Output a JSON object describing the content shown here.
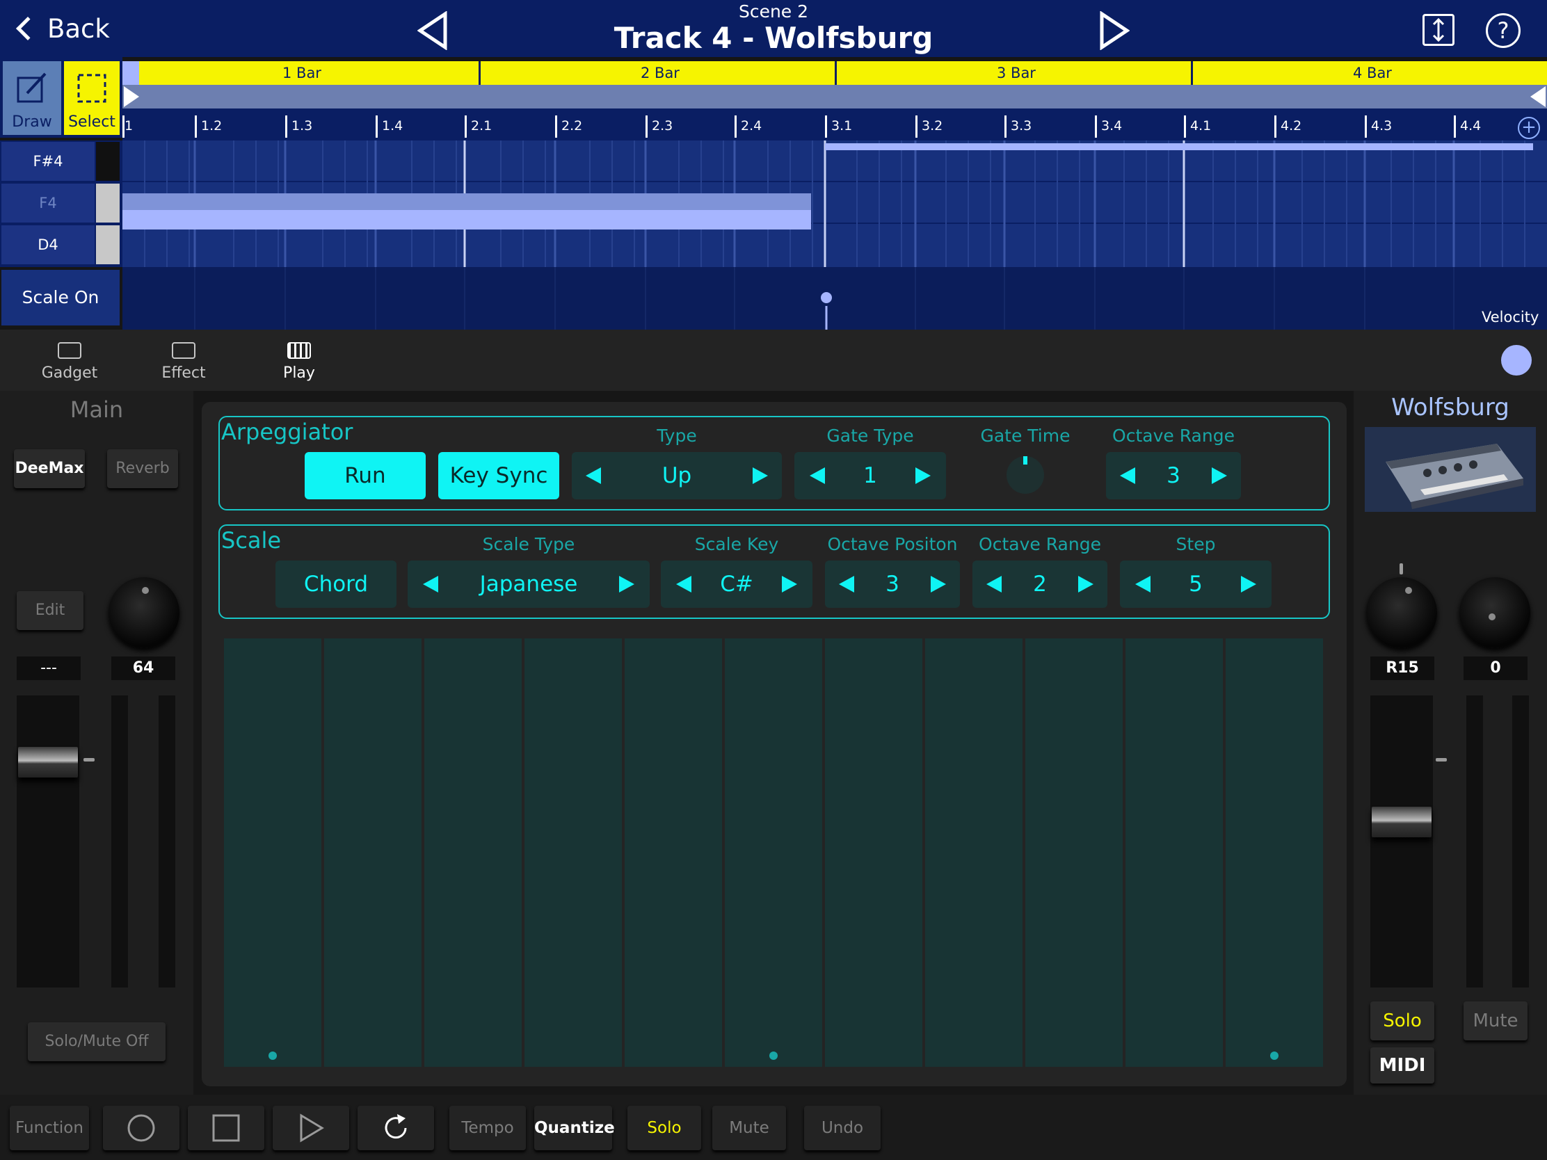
{
  "header": {
    "back_label": "Back",
    "scene_label": "Scene 2",
    "track_title": "Track 4 - Wolfsburg"
  },
  "tools": {
    "draw_label": "Draw",
    "select_label": "Select"
  },
  "timeline": {
    "bars": [
      "1 Bar",
      "2 Bar",
      "3 Bar",
      "4 Bar"
    ],
    "beats": [
      "1",
      "1.2",
      "1.3",
      "1.4",
      "2.1",
      "2.2",
      "2.3",
      "2.4",
      "3.1",
      "3.2",
      "3.3",
      "3.4",
      "4.1",
      "4.2",
      "4.3",
      "4.4"
    ]
  },
  "piano_roll": {
    "keys": [
      "F#4",
      "F4",
      "D4"
    ],
    "scale_label": "Scale On",
    "velocity_label": "Velocity"
  },
  "tabs": {
    "gadget": "Gadget",
    "effect": "Effect",
    "play": "Play"
  },
  "left_mixer": {
    "title": "Main",
    "deemax_label": "DeeMax",
    "reverb_label": "Reverb",
    "edit_label": "Edit",
    "left_value": "---",
    "knob_value": "64",
    "solo_mute_label": "Solo/Mute Off"
  },
  "right_mixer": {
    "gadget_name": "Wolfsburg",
    "pan_value": "R15",
    "send_value": "0",
    "solo_label": "Solo",
    "mute_label": "Mute",
    "midi_label": "MIDI"
  },
  "arpeggiator": {
    "title": "Arpeggiator",
    "run_label": "Run",
    "key_sync_label": "Key Sync",
    "type_label": "Type",
    "type_value": "Up",
    "gate_type_label": "Gate Type",
    "gate_type_value": "1",
    "gate_time_label": "Gate Time",
    "octave_range_label": "Octave Range",
    "octave_range_value": "3"
  },
  "scale": {
    "title": "Scale",
    "chord_label": "Chord",
    "scale_type_label": "Scale Type",
    "scale_type_value": "Japanese",
    "scale_key_label": "Scale Key",
    "scale_key_value": "C#",
    "octave_position_label": "Octave Positon",
    "octave_position_value": "3",
    "octave_range_label": "Octave Range",
    "octave_range_value": "2",
    "step_label": "Step",
    "step_value": "5"
  },
  "transport": {
    "function_label": "Function",
    "tempo_label": "Tempo",
    "quantize_label": "Quantize",
    "solo_label": "Solo",
    "mute_label": "Mute",
    "undo_label": "Undo"
  },
  "colors": {
    "header_bg": "#0a1e63",
    "accent_cyan": "#0ff4f4",
    "ruler_yellow": "#f6f400",
    "note_blue": "#a6b5ff"
  }
}
